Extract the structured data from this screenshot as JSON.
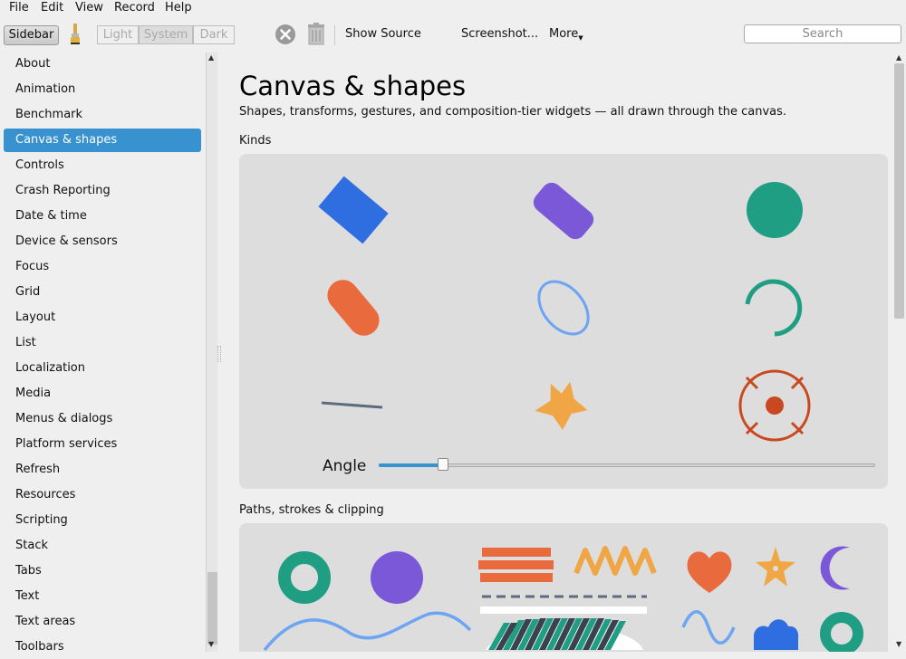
{
  "menubar": {
    "items": [
      "File",
      "Edit",
      "View",
      "Record",
      "Help"
    ]
  },
  "toolbar": {
    "sidebar_label": "Sidebar",
    "theme": {
      "options": [
        "Light",
        "System",
        "Dark"
      ],
      "selected": "System"
    },
    "show_source_label": "Show Source",
    "screenshot_label": "Screenshot...",
    "more_label": "More",
    "search_placeholder": "Search"
  },
  "sidebar": {
    "selected": "Canvas & shapes",
    "items": [
      "About",
      "Animation",
      "Benchmark",
      "Canvas & shapes",
      "Controls",
      "Crash Reporting",
      "Date & time",
      "Device & sensors",
      "Focus",
      "Grid",
      "Layout",
      "List",
      "Localization",
      "Media",
      "Menus & dialogs",
      "Platform services",
      "Refresh",
      "Resources",
      "Scripting",
      "Stack",
      "Tabs",
      "Text",
      "Text areas",
      "Toolbars"
    ]
  },
  "main": {
    "title": "Canvas & shapes",
    "description": "Shapes, transforms, gestures, and composition-tier widgets — all drawn through the canvas.",
    "kinds": {
      "title": "Kinds",
      "angle_label": "Angle",
      "angle_fraction": 0.13
    },
    "paths": {
      "title": "Paths, strokes & clipping"
    }
  },
  "colors": {
    "blue": "#2f6ee0",
    "purple": "#7b58d8",
    "teal": "#1f9e83",
    "orange": "#e96a3d",
    "light_blue": "#6ea5f2",
    "slate": "#5d6b80",
    "gold": "#f0a645",
    "rust": "#c8491f",
    "accent": "#3892cf"
  }
}
